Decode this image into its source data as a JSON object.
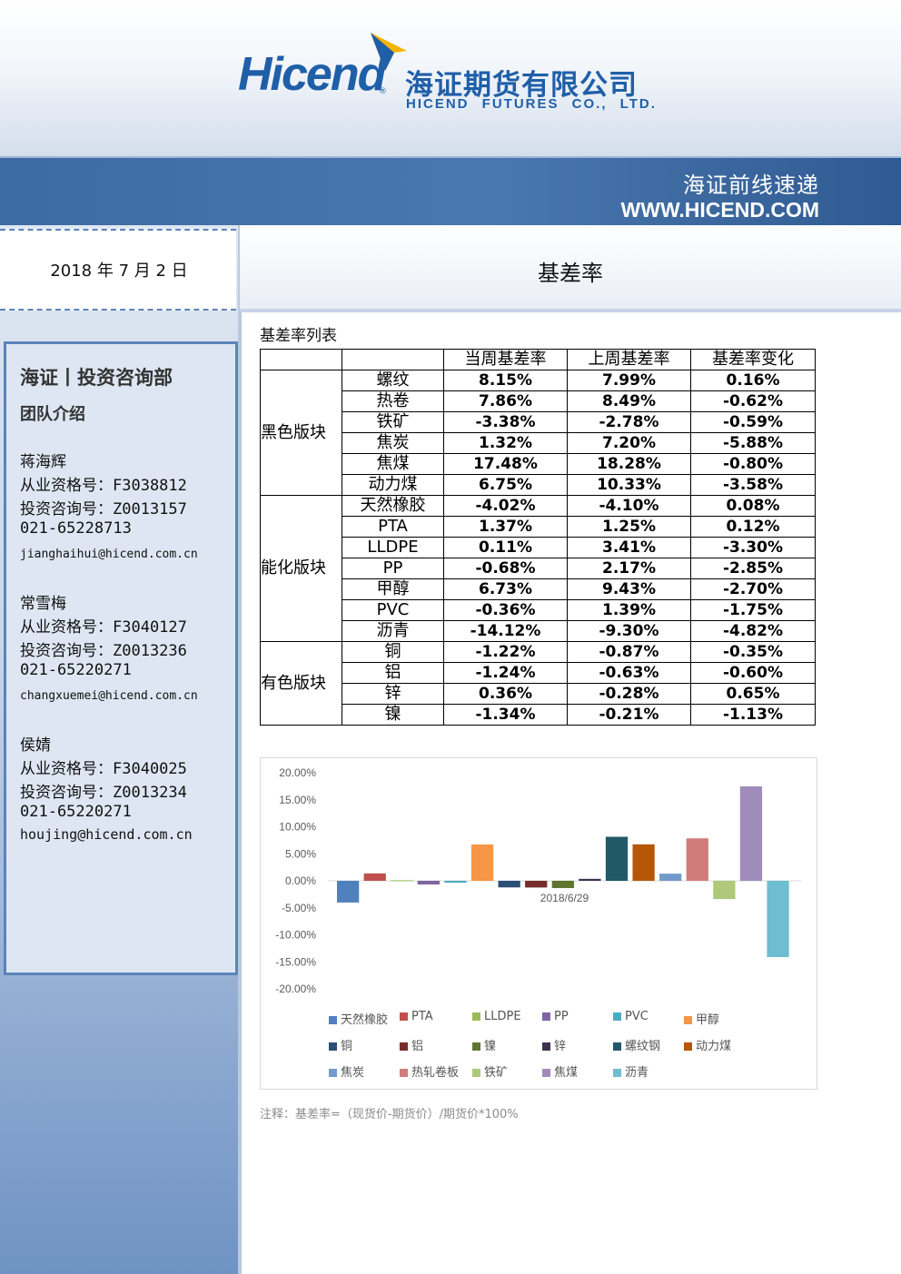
{
  "header": {
    "logo_en": "Hicend",
    "logo_cn": "海证期货有限公司",
    "logo_sub": "HICEND FUTURES CO., LTD.",
    "brand_color": "#1f5fa8",
    "banner_title": "海证前线速递",
    "banner_url": "WWW.HICEND.COM"
  },
  "date": "2018 年 7 月 2 日",
  "doc_title": "基差率",
  "sidebar": {
    "heading": "海证丨投资咨询部",
    "subheading": "团队介绍",
    "members": [
      {
        "name": "蒋海辉",
        "qual": "从业资格号：F3038812",
        "invest": "投资咨询号：Z0013157",
        "phone": "021-65228713",
        "email": "jianghaihui@hicend.com.cn"
      },
      {
        "name": "常雪梅",
        "qual": "从业资格号：F3040127",
        "invest": "投资咨询号：Z0013236",
        "phone": "021-65220271",
        "email": "changxuemei@hicend.com.cn"
      },
      {
        "name": "侯婧",
        "qual": "从业资格号：F3040025",
        "invest": "投资咨询号：Z0013234",
        "phone": "021-65220271",
        "email": "houjing@hicend.com.cn"
      }
    ]
  },
  "table": {
    "label": "基差率列表",
    "headers": [
      "当周基差率",
      "上周基差率",
      "基差率变化"
    ],
    "sections": [
      {
        "name": "黑色版块",
        "rows": [
          {
            "product": "螺纹",
            "cur": "8.15%",
            "prev": "7.99%",
            "chg": "0.16%"
          },
          {
            "product": "热卷",
            "cur": "7.86%",
            "prev": "8.49%",
            "chg": "-0.62%"
          },
          {
            "product": "铁矿",
            "cur": "-3.38%",
            "prev": "-2.78%",
            "chg": "-0.59%"
          },
          {
            "product": "焦炭",
            "cur": "1.32%",
            "prev": "7.20%",
            "chg": "-5.88%"
          },
          {
            "product": "焦煤",
            "cur": "17.48%",
            "prev": "18.28%",
            "chg": "-0.80%"
          },
          {
            "product": "动力煤",
            "cur": "6.75%",
            "prev": "10.33%",
            "chg": "-3.58%"
          }
        ]
      },
      {
        "name": "能化版块",
        "rows": [
          {
            "product": "天然橡胶",
            "cur": "-4.02%",
            "prev": "-4.10%",
            "chg": "0.08%"
          },
          {
            "product": "PTA",
            "cur": "1.37%",
            "prev": "1.25%",
            "chg": "0.12%"
          },
          {
            "product": "LLDPE",
            "cur": "0.11%",
            "prev": "3.41%",
            "chg": "-3.30%"
          },
          {
            "product": "PP",
            "cur": "-0.68%",
            "prev": "2.17%",
            "chg": "-2.85%"
          },
          {
            "product": "甲醇",
            "cur": "6.73%",
            "prev": "9.43%",
            "chg": "-2.70%"
          },
          {
            "product": "PVC",
            "cur": "-0.36%",
            "prev": "1.39%",
            "chg": "-1.75%"
          },
          {
            "product": "沥青",
            "cur": "-14.12%",
            "prev": "-9.30%",
            "chg": "-4.82%"
          }
        ]
      },
      {
        "name": "有色版块",
        "rows": [
          {
            "product": "铜",
            "cur": "-1.22%",
            "prev": "-0.87%",
            "chg": "-0.35%"
          },
          {
            "product": "铝",
            "cur": "-1.24%",
            "prev": "-0.63%",
            "chg": "-0.60%"
          },
          {
            "product": "锌",
            "cur": "0.36%",
            "prev": "-0.28%",
            "chg": "0.65%"
          },
          {
            "product": "镍",
            "cur": "-1.34%",
            "prev": "-0.21%",
            "chg": "-1.13%"
          }
        ]
      }
    ]
  },
  "chart_data": {
    "type": "bar",
    "categories": [
      "2018/6/29"
    ],
    "ylim": [
      -20,
      20
    ],
    "yticks": [
      "20.00%",
      "15.00%",
      "10.00%",
      "5.00%",
      "0.00%",
      "-5.00%",
      "-10.00%",
      "-15.00%",
      "-20.00%"
    ],
    "grid": false,
    "legend_position": "bottom",
    "series": [
      {
        "name": "天然橡胶",
        "values": [
          -4.02
        ],
        "color": "#4f81bd"
      },
      {
        "name": "PTA",
        "values": [
          1.37
        ],
        "color": "#c0504d"
      },
      {
        "name": "LLDPE",
        "values": [
          0.11
        ],
        "color": "#9bbb59"
      },
      {
        "name": "PP",
        "values": [
          -0.68
        ],
        "color": "#8064a2"
      },
      {
        "name": "PVC",
        "values": [
          -0.36
        ],
        "color": "#4bacc6"
      },
      {
        "name": "甲醇",
        "values": [
          6.73
        ],
        "color": "#f79646"
      },
      {
        "name": "铜",
        "values": [
          -1.22
        ],
        "color": "#2c4d75"
      },
      {
        "name": "铝",
        "values": [
          -1.24
        ],
        "color": "#772c2a"
      },
      {
        "name": "镍",
        "values": [
          -1.34
        ],
        "color": "#5f7530"
      },
      {
        "name": "锌",
        "values": [
          0.36
        ],
        "color": "#403152"
      },
      {
        "name": "螺纹钢",
        "values": [
          8.15
        ],
        "color": "#215968"
      },
      {
        "name": "动力煤",
        "values": [
          6.75
        ],
        "color": "#b65708"
      },
      {
        "name": "焦炭",
        "values": [
          1.32
        ],
        "color": "#729aca"
      },
      {
        "name": "热轧卷板",
        "values": [
          7.86
        ],
        "color": "#d07c7a"
      },
      {
        "name": "铁矿",
        "values": [
          -3.38
        ],
        "color": "#afc97a"
      },
      {
        "name": "焦煤",
        "values": [
          17.48
        ],
        "color": "#9f8cbb"
      },
      {
        "name": "沥青",
        "values": [
          -14.12
        ],
        "color": "#6fbdd1"
      }
    ]
  },
  "note": "注释：基差率=（现货价-期货价）/期货价*100%"
}
